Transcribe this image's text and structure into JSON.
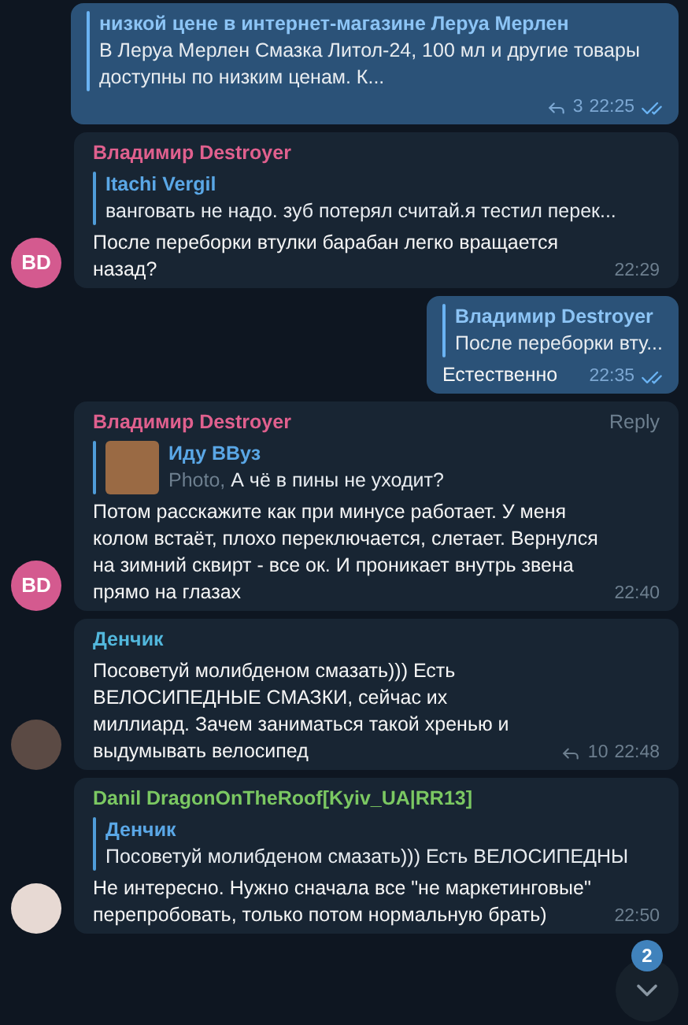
{
  "messages": [
    {
      "kind": "outgoing",
      "reply": {
        "name": "низкой цене в интернет-магазине Леруа Мерлен",
        "text": "В Леруа Мерлен Смазка Литол-24, 100 мл и другие товары доступны по низким ценам. К..."
      },
      "replies": "3",
      "time": "22:25",
      "read": true
    },
    {
      "kind": "incoming",
      "sender": "Владимир Destroyer",
      "color": "#e0608e",
      "reply": {
        "name": "Itachi Vergil",
        "text": "ванговать не надо. зуб потерял считай.я тестил перек..."
      },
      "text": "После переборки втулки барабан легко вращается назад?",
      "time": "22:29",
      "avatar": {
        "kind": "initials",
        "initials": "BD"
      }
    },
    {
      "kind": "outgoing",
      "reply": {
        "name": "Владимир Destroyer",
        "text": "После переборки вту..."
      },
      "text": "Естественно",
      "time": "22:35",
      "read": true
    },
    {
      "kind": "incoming",
      "sender": "Владимир Destroyer",
      "color": "#e0608e",
      "action": "Reply",
      "reply": {
        "name": "Иду ВВуз",
        "prefix": "Photo,",
        "text": "А чё в пины не уходит?",
        "thumbnail": true
      },
      "text": "Потом расскажите как при минусе работает. У меня колом встаёт, плохо переключается, слетает. Вернулся на зимний сквирт - все ок. И проникает внутрь звена прямо на глазах",
      "time": "22:40",
      "avatar": {
        "kind": "initials",
        "initials": "BD"
      }
    },
    {
      "kind": "incoming",
      "sender": "Денчик",
      "color": "#52b7dc",
      "text": "Посоветуй молибденом смазать))) Есть ВЕЛОСИПЕДНЫЕ СМАЗКИ, сейчас их миллиард. Зачем заниматься такой хренью и выдумывать велосипед",
      "replies": "10",
      "time": "22:48",
      "avatar": {
        "kind": "photo"
      }
    },
    {
      "kind": "incoming",
      "sender": "Danil DragonOnTheRoof[Kyiv_UA|RR13]",
      "color": "#7bc862",
      "reply": {
        "name": "Денчик",
        "text": "Посоветуй молибденом смазать))) Есть ВЕЛОСИПЕДНЫ"
      },
      "text": "Не интересно. Нужно сначала все \"не маркетинговые\" перепробовать, только потом нормальную брать)",
      "time": "22:50",
      "avatar": {
        "kind": "picture"
      }
    }
  ],
  "scroll_button": {
    "badge": "2"
  }
}
